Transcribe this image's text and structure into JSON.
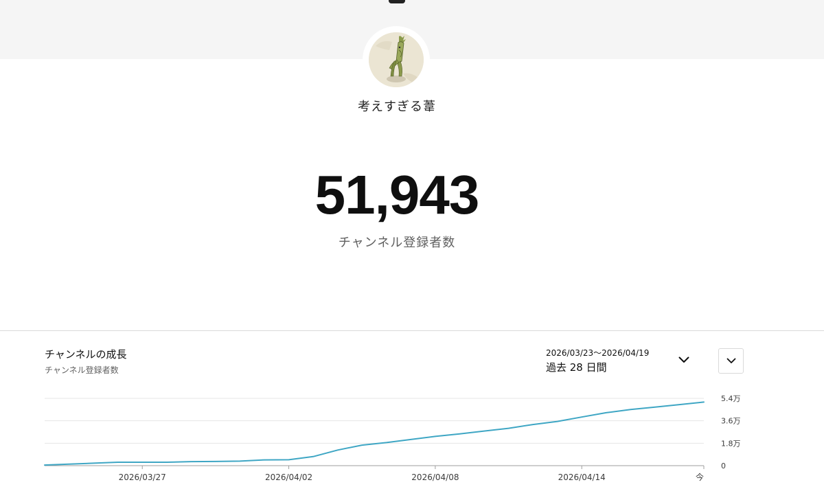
{
  "header": {
    "channel_name": "考えすぎる葦"
  },
  "stats": {
    "subscriber_count": "51,943",
    "subscriber_label": "チャンネル登録者数"
  },
  "growth_card": {
    "title": "チャンネルの成長",
    "subtitle": "チャンネル登録者数",
    "date_range": "2026/03/23～2026/04/19",
    "period_label": "過去 28 日間"
  },
  "icons": {
    "period_dropdown": "chevron-down-icon",
    "metric_select": "chevron-down-icon",
    "avatar": "reed-figure-avatar"
  },
  "colors": {
    "line": "#3ea6c4",
    "banner": "#f5f5f5"
  },
  "chart_data": {
    "type": "line",
    "x": [
      "2026/03/23",
      "2026/03/24",
      "2026/03/25",
      "2026/03/26",
      "2026/03/27",
      "2026/03/28",
      "2026/03/29",
      "2026/03/30",
      "2026/03/31",
      "2026/04/01",
      "2026/04/02",
      "2026/04/03",
      "2026/04/04",
      "2026/04/05",
      "2026/04/06",
      "2026/04/07",
      "2026/04/08",
      "2026/04/09",
      "2026/04/10",
      "2026/04/11",
      "2026/04/12",
      "2026/04/13",
      "2026/04/14",
      "2026/04/15",
      "2026/04/16",
      "2026/04/17",
      "2026/04/18",
      "2026/04/19"
    ],
    "values": [
      1000,
      2500,
      4000,
      5500,
      5500,
      5500,
      6500,
      6700,
      7300,
      9300,
      9500,
      14500,
      25000,
      33000,
      37000,
      42000,
      47000,
      51000,
      55500,
      60000,
      66000,
      71000,
      78000,
      85000,
      90000,
      94000,
      98000,
      102000
    ],
    "xticks": [
      {
        "date": "2026/03/27",
        "label": "2026/03/27"
      },
      {
        "date": "2026/04/02",
        "label": "2026/04/02"
      },
      {
        "date": "2026/04/08",
        "label": "2026/04/08"
      },
      {
        "date": "2026/04/14",
        "label": "2026/04/14"
      },
      {
        "date": "2026/04/19",
        "label": "今"
      }
    ],
    "yticks": [
      {
        "value": 0,
        "label": "0"
      },
      {
        "value": 36000,
        "label": "1.8万"
      },
      {
        "value": 72000,
        "label": "3.6万"
      },
      {
        "value": 108000,
        "label": "5.4万"
      }
    ],
    "ylim": [
      0,
      108000
    ],
    "grid": true
  }
}
